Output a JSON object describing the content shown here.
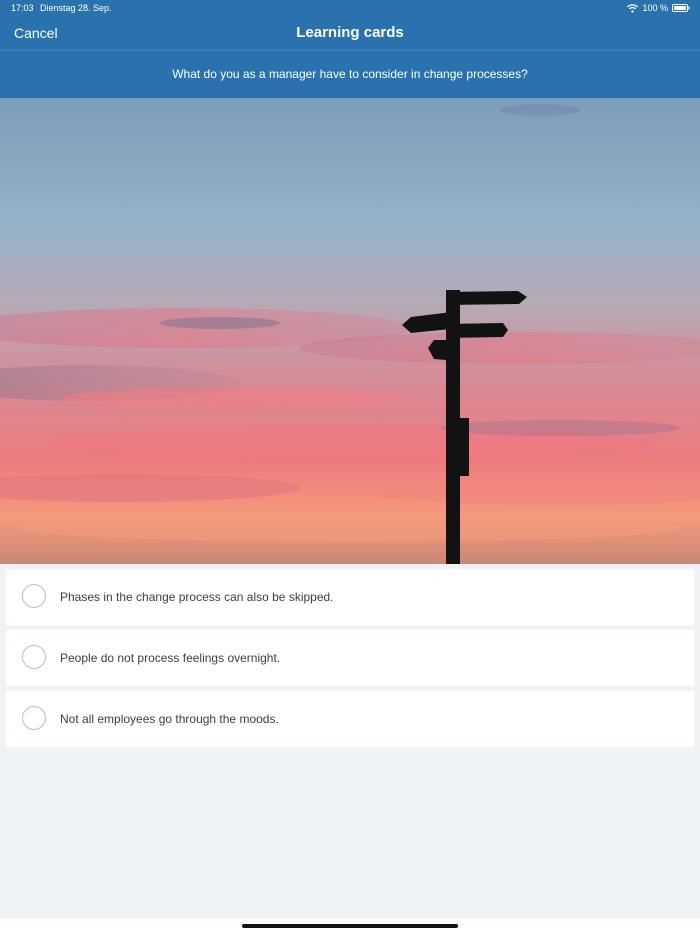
{
  "status_bar": {
    "time": "17:03",
    "date": "Dienstag 28. Sep.",
    "battery": "100 %",
    "icons": [
      "wifi-icon",
      "battery-icon"
    ]
  },
  "nav": {
    "cancel_label": "Cancel",
    "title": "Learning cards"
  },
  "question": "What do you as a manager have to consider in change processes?",
  "image": {
    "subject": "signpost-silhouette-at-sunset"
  },
  "answers": [
    {
      "label": "Phases in the change process can also be skipped.",
      "selected": false
    },
    {
      "label": "People do not process feelings overnight.",
      "selected": false
    },
    {
      "label": "Not all employees go through the moods.",
      "selected": false
    }
  ],
  "colors": {
    "header": "#2a72ae",
    "background": "#f0f3f6"
  }
}
